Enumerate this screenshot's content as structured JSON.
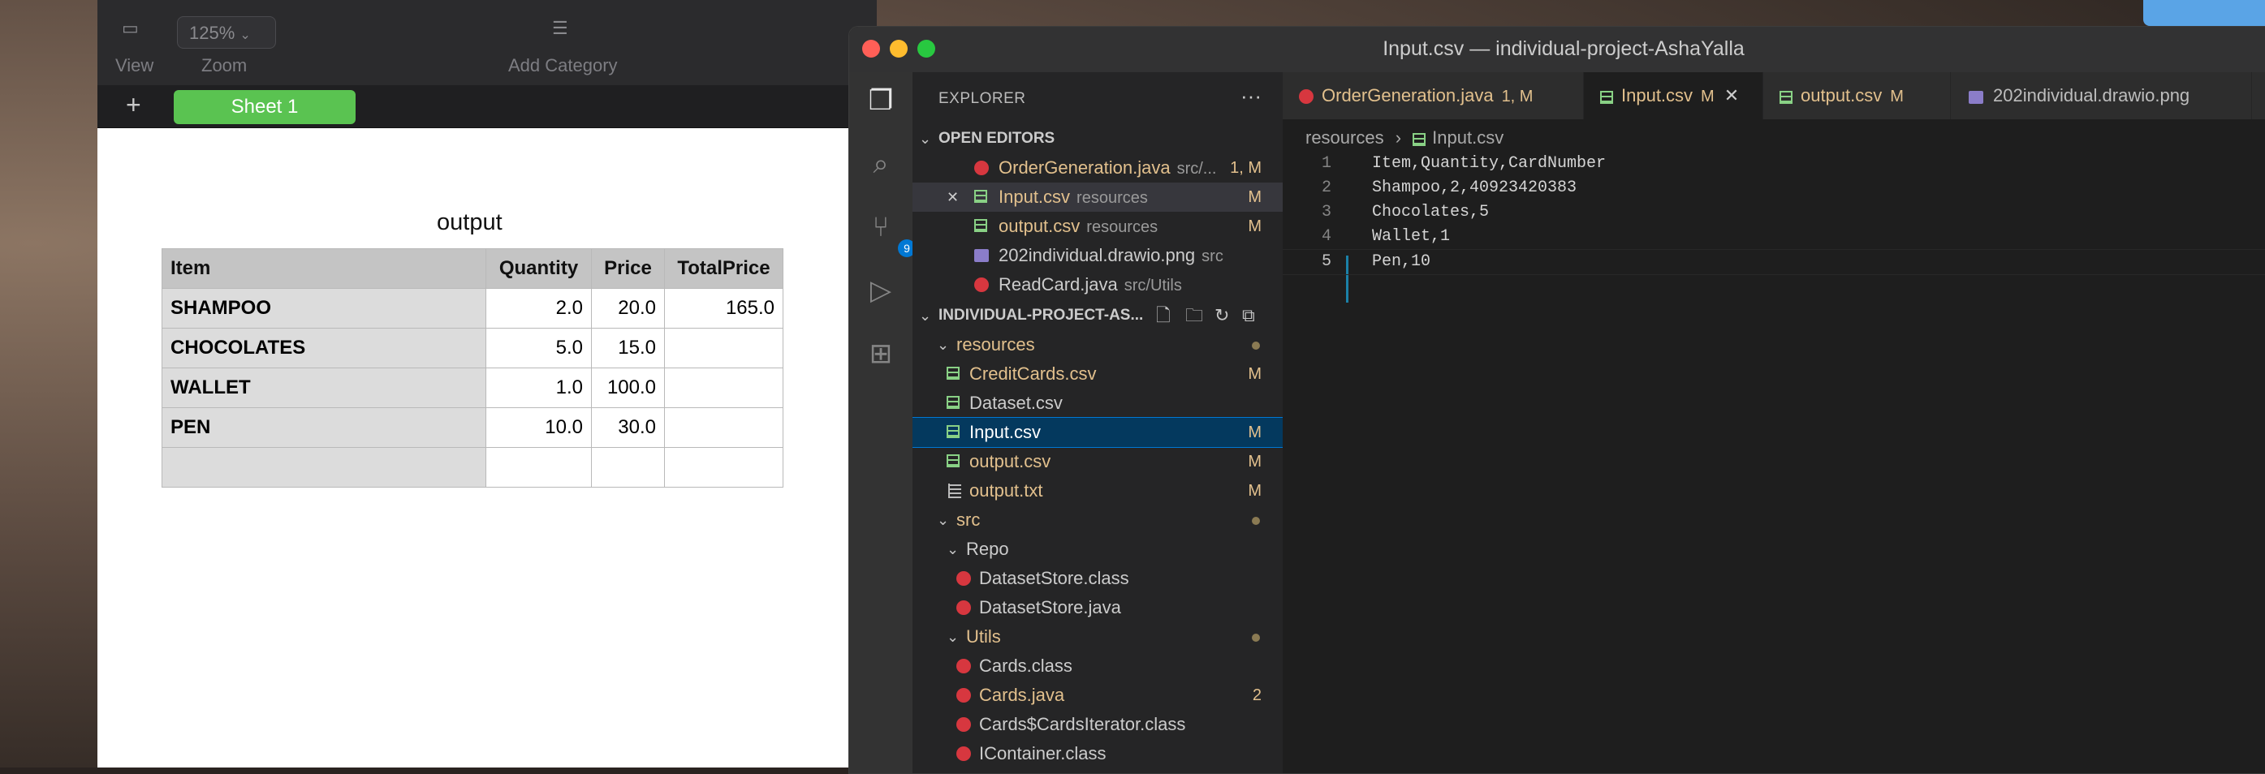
{
  "numbers": {
    "zoom": "125%",
    "toolbar_labels": {
      "view": "View",
      "zoom": "Zoom",
      "add_category": "Add Category"
    },
    "sheet_tab": "Sheet 1",
    "sheet_title": "output",
    "table": {
      "headers": [
        "Item",
        "Quantity",
        "Price",
        "TotalPrice"
      ],
      "rows": [
        [
          "SHAMPOO",
          "2.0",
          "20.0",
          "165.0"
        ],
        [
          "CHOCOLATES",
          "5.0",
          "15.0",
          ""
        ],
        [
          "WALLET",
          "1.0",
          "100.0",
          ""
        ],
        [
          "PEN",
          "10.0",
          "30.0",
          ""
        ],
        [
          "",
          "",
          "",
          ""
        ]
      ]
    }
  },
  "vscode": {
    "window_title": "Input.csv — individual-project-AshaYalla",
    "source_control_badge": "9",
    "explorer_title": "EXPLORER",
    "open_editors_label": "OPEN EDITORS",
    "open_editors": [
      {
        "name": "OrderGeneration.java",
        "path": "src/...",
        "status": "1, M",
        "icon": "java"
      },
      {
        "name": "Input.csv",
        "path": "resources",
        "status": "M",
        "icon": "csv"
      },
      {
        "name": "output.csv",
        "path": "resources",
        "status": "M",
        "icon": "csv"
      },
      {
        "name": "202individual.drawio.png",
        "path": "src",
        "status": "",
        "icon": "png"
      },
      {
        "name": "ReadCard.java",
        "path": "src/Utils",
        "status": "",
        "icon": "java"
      }
    ],
    "project_label": "INDIVIDUAL-PROJECT-AS...",
    "tree": {
      "resources": "resources",
      "resources_files": [
        {
          "name": "CreditCards.csv",
          "status": "M",
          "icon": "csv"
        },
        {
          "name": "Dataset.csv",
          "status": "",
          "icon": "csv"
        },
        {
          "name": "Input.csv",
          "status": "M",
          "icon": "csv"
        },
        {
          "name": "output.csv",
          "status": "M",
          "icon": "csv"
        },
        {
          "name": "output.txt",
          "status": "M",
          "icon": "txt"
        }
      ],
      "src": "src",
      "repo": "Repo",
      "repo_files": [
        "DatasetStore.class",
        "DatasetStore.java"
      ],
      "utils": "Utils",
      "utils_files": [
        {
          "name": "Cards.class",
          "status": ""
        },
        {
          "name": "Cards.java",
          "status": "2"
        },
        {
          "name": "Cards$CardsIterator.class",
          "status": ""
        },
        {
          "name": "IContainer.class",
          "status": ""
        }
      ]
    },
    "tabs": [
      {
        "name": "OrderGeneration.java",
        "status": "1, M"
      },
      {
        "name": "Input.csv",
        "status": "M"
      },
      {
        "name": "output.csv",
        "status": "M"
      },
      {
        "name": "202individual.drawio.png",
        "status": ""
      }
    ],
    "breadcrumb": [
      "resources",
      "Input.csv"
    ],
    "code_lines": [
      "Item,Quantity,CardNumber",
      "Shampoo,2,40923420383",
      "Chocolates,5",
      "Wallet,1",
      "Pen,10"
    ],
    "line_numbers": [
      "1",
      "2",
      "3",
      "4",
      "5"
    ]
  },
  "colors": {
    "accent_green": "#5ac351",
    "modified": "#e2c08d",
    "selection": "#04395e"
  }
}
